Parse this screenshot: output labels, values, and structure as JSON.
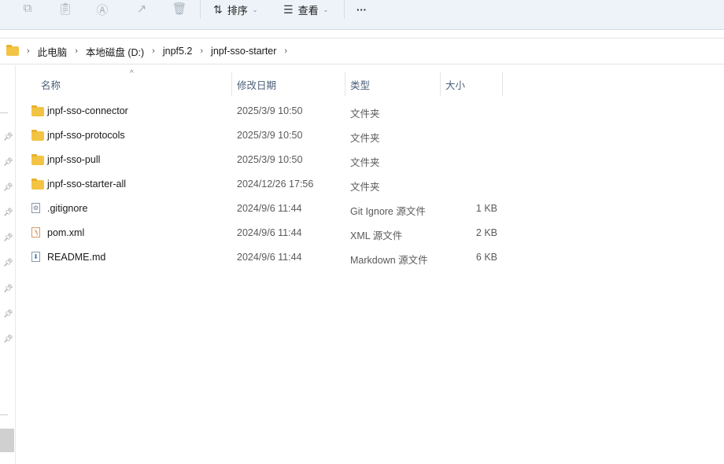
{
  "toolbar": {
    "sort_label": "排序",
    "view_label": "查看",
    "more_label": "···"
  },
  "breadcrumb": [
    "此电脑",
    "本地磁盘 (D:)",
    "jnpf5.2",
    "jnpf-sso-starter"
  ],
  "columns": {
    "name": "名称",
    "date": "修改日期",
    "type": "类型",
    "size": "大小"
  },
  "files": [
    {
      "name": "jnpf-sso-connector",
      "date": "2025/3/9 10:50",
      "type": "文件夹",
      "size": "",
      "icon": "folder"
    },
    {
      "name": "jnpf-sso-protocols",
      "date": "2025/3/9 10:50",
      "type": "文件夹",
      "size": "",
      "icon": "folder"
    },
    {
      "name": "jnpf-sso-pull",
      "date": "2025/3/9 10:50",
      "type": "文件夹",
      "size": "",
      "icon": "folder"
    },
    {
      "name": "jnpf-sso-starter-all",
      "date": "2024/12/26 17:56",
      "type": "文件夹",
      "size": "",
      "icon": "folder"
    },
    {
      "name": ".gitignore",
      "date": "2024/9/6 11:44",
      "type": "Git Ignore 源文件",
      "size": "1 KB",
      "icon": "gear-file"
    },
    {
      "name": "pom.xml",
      "date": "2024/9/6 11:44",
      "type": "XML 源文件",
      "size": "2 KB",
      "icon": "rss-file"
    },
    {
      "name": "README.md",
      "date": "2024/9/6 11:44",
      "type": "Markdown 源文件",
      "size": "6 KB",
      "icon": "download-file"
    }
  ]
}
